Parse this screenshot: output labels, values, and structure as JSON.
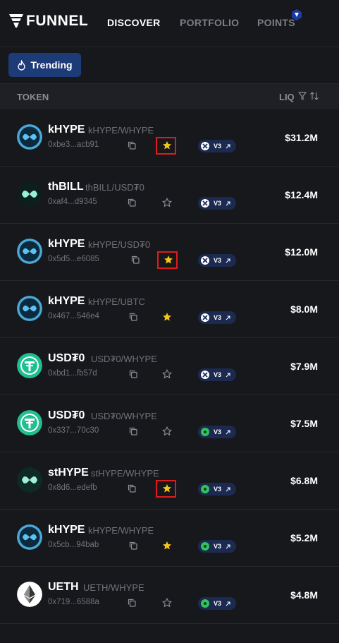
{
  "header": {
    "logo_text": "FUNNEL",
    "nav": [
      {
        "label": "DISCOVER",
        "active": true
      },
      {
        "label": "PORTFOLIO",
        "active": false
      },
      {
        "label": "POINTS",
        "active": false
      }
    ]
  },
  "filters": {
    "trending_label": "Trending"
  },
  "table": {
    "col_token": "TOKEN",
    "col_liq": "LIQ",
    "rows": [
      {
        "name": "kHYPE",
        "pair": "kHYPE/WHYPE",
        "address": "0xbe3...acb91",
        "starred": true,
        "highlighted": true,
        "pool": "V3",
        "pool_kind": "x",
        "liq": "$31.2M",
        "icon": "khype"
      },
      {
        "name": "thBILL",
        "pair": "thBILL/USD₮0",
        "address": "0xaf4...d9345",
        "starred": false,
        "highlighted": false,
        "pool": "V3",
        "pool_kind": "x",
        "liq": "$12.4M",
        "icon": "thbill"
      },
      {
        "name": "kHYPE",
        "pair": "kHYPE/USD₮0",
        "address": "0x5d5...e6085",
        "starred": true,
        "highlighted": true,
        "pool": "V3",
        "pool_kind": "x",
        "liq": "$12.0M",
        "icon": "khype"
      },
      {
        "name": "kHYPE",
        "pair": "kHYPE/UBTC",
        "address": "0x467...546e4",
        "starred": true,
        "highlighted": false,
        "pool": "V3",
        "pool_kind": "x",
        "liq": "$8.0M",
        "icon": "khype"
      },
      {
        "name": "USD₮0",
        "pair": "USD₮0/WHYPE",
        "address": "0xbd1...fb57d",
        "starred": false,
        "highlighted": false,
        "pool": "V3",
        "pool_kind": "x",
        "liq": "$7.9M",
        "icon": "usdt0"
      },
      {
        "name": "USD₮0",
        "pair": "USD₮0/WHYPE",
        "address": "0x337...70c30",
        "starred": false,
        "highlighted": false,
        "pool": "V3",
        "pool_kind": "g",
        "liq": "$7.5M",
        "icon": "usdt0"
      },
      {
        "name": "stHYPE",
        "pair": "stHYPE/WHYPE",
        "address": "0x8d6...edefb",
        "starred": true,
        "highlighted": true,
        "pool": "V3",
        "pool_kind": "g",
        "liq": "$6.8M",
        "icon": "sthype"
      },
      {
        "name": "kHYPE",
        "pair": "kHYPE/WHYPE",
        "address": "0x5cb...94bab",
        "starred": true,
        "highlighted": false,
        "pool": "V3",
        "pool_kind": "g",
        "liq": "$5.2M",
        "icon": "khype"
      },
      {
        "name": "UETH",
        "pair": "UETH/WHYPE",
        "address": "0x719...6588a",
        "starred": false,
        "highlighted": false,
        "pool": "V3",
        "pool_kind": "g",
        "liq": "$4.8M",
        "icon": "ueth"
      }
    ]
  },
  "colors": {
    "background": "#17181c",
    "accent": "#1d3b77",
    "star": "#f5c518",
    "highlight": "#e11b1b",
    "pool_green": "#2ec55a"
  }
}
